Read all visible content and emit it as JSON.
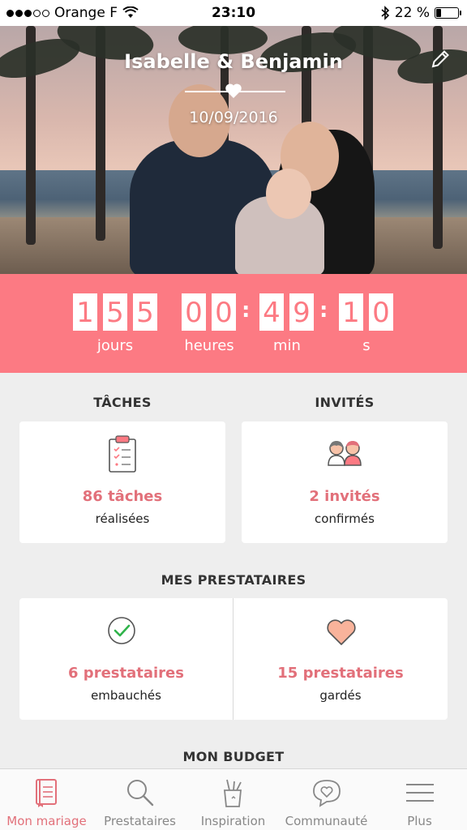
{
  "status_bar": {
    "carrier": "Orange F",
    "time": "23:10",
    "battery": "22 %",
    "battery_level": 0.22
  },
  "hero": {
    "couple_names": "Isabelle & Benjamin",
    "wedding_date": "10/09/2016"
  },
  "countdown": {
    "days_digits": [
      "1",
      "5",
      "5"
    ],
    "hours_digits": [
      "0",
      "0"
    ],
    "minutes_digits": [
      "4",
      "9"
    ],
    "seconds_digits": [
      "1",
      "0"
    ],
    "labels": {
      "days": "jours",
      "hours": "heures",
      "minutes": "min",
      "seconds": "s"
    }
  },
  "tasks": {
    "title": "TÂCHES",
    "value": "86 tâches",
    "label": "réalisées"
  },
  "guests": {
    "title": "INVITÉS",
    "value": "2 invités",
    "label": "confirmés"
  },
  "vendors": {
    "title": "MES PRESTATAIRES",
    "hired": {
      "value": "6 prestataires",
      "label": "embauchés"
    },
    "saved": {
      "value": "15 prestataires",
      "label": "gardés"
    }
  },
  "budget": {
    "title": "MON BUDGET"
  },
  "tabbar": {
    "items": [
      {
        "label": "Mon mariage",
        "icon": "notebook-icon",
        "active": true
      },
      {
        "label": "Prestataires",
        "icon": "search-icon",
        "active": false
      },
      {
        "label": "Inspiration",
        "icon": "pencil-cup-icon",
        "active": false
      },
      {
        "label": "Communauté",
        "icon": "chat-heart-icon",
        "active": false
      },
      {
        "label": "Plus",
        "icon": "menu-icon",
        "active": false
      }
    ]
  },
  "colors": {
    "accent": "#fc7a83",
    "accent_text": "#e2707a",
    "background": "#eeeeee",
    "card": "#ffffff"
  }
}
